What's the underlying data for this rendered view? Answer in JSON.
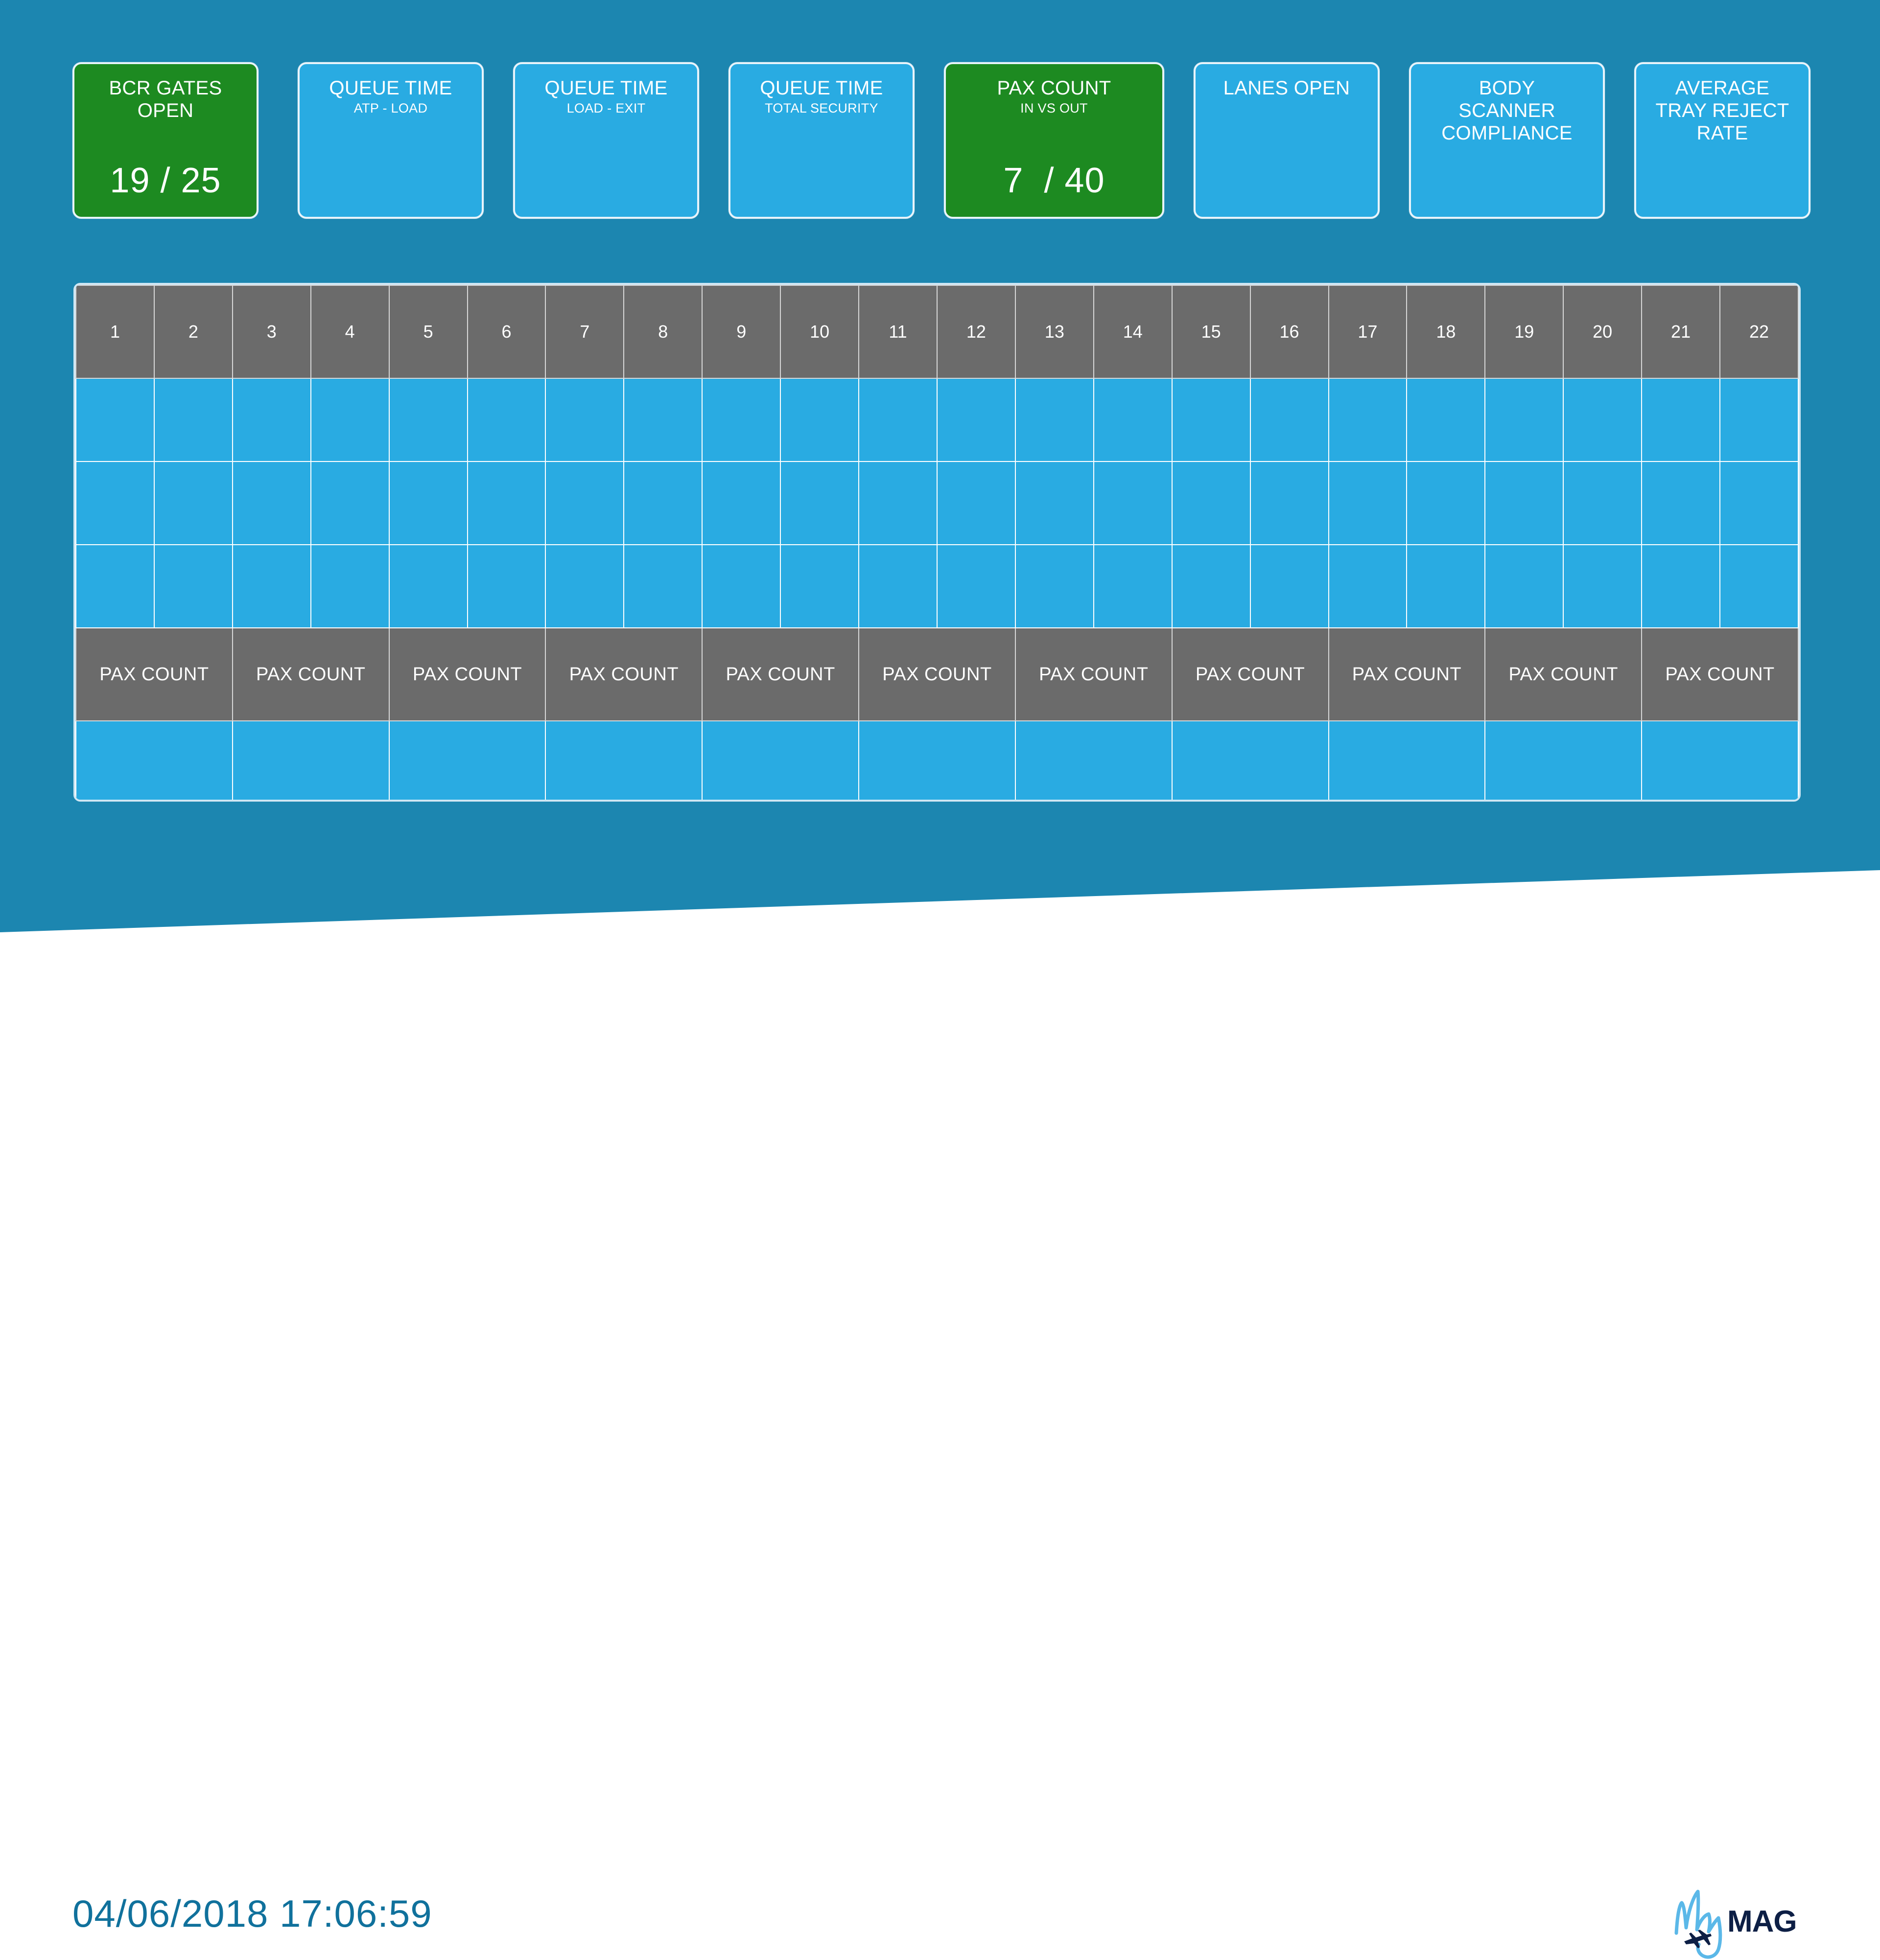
{
  "theme": {
    "background_teal": "#1c86b0",
    "card_blue": "#29abe2",
    "card_green": "#1d8a21",
    "card_border": "#e8f4fb",
    "grid_header_gray": "#6b6b6b",
    "footer_white": "#ffffff",
    "timestamp_color": "#10719c",
    "logo_script_color": "#5bb8e8",
    "logo_text_color": "#0d1f45"
  },
  "kpi_cards": [
    {
      "title": "BCR GATES\nOPEN",
      "subtitle": "",
      "value": "19 / 25",
      "state": "green"
    },
    {
      "title": "QUEUE TIME",
      "subtitle": "ATP - LOAD",
      "value": "",
      "state": "blue"
    },
    {
      "title": "QUEUE TIME",
      "subtitle": "LOAD - EXIT",
      "value": "",
      "state": "blue"
    },
    {
      "title": "QUEUE TIME",
      "subtitle": "TOTAL SECURITY",
      "value": "",
      "state": "blue"
    },
    {
      "title": "PAX COUNT",
      "subtitle": "IN VS OUT",
      "value": "7  / 40",
      "state": "green"
    },
    {
      "title": "LANES OPEN",
      "subtitle": "",
      "value": "",
      "state": "blue"
    },
    {
      "title": "BODY\nSCANNER\nCOMPLIANCE",
      "subtitle": "",
      "value": "",
      "state": "blue"
    },
    {
      "title": "AVERAGE\nTRAY REJECT\nRATE",
      "subtitle": "",
      "value": "",
      "state": "blue"
    }
  ],
  "grid": {
    "column_headers": [
      "1",
      "2",
      "3",
      "4",
      "5",
      "6",
      "7",
      "8",
      "9",
      "10",
      "11",
      "12",
      "13",
      "14",
      "15",
      "16",
      "17",
      "18",
      "19",
      "20",
      "21",
      "22"
    ],
    "blank_row_1": [
      "",
      "",
      "",
      "",
      "",
      "",
      "",
      "",
      "",
      "",
      "",
      "",
      "",
      "",
      "",
      "",
      "",
      "",
      "",
      "",
      "",
      ""
    ],
    "blank_row_2": [
      "",
      "",
      "",
      "",
      "",
      "",
      "",
      "",
      "",
      "",
      "",
      "",
      "",
      "",
      "",
      "",
      "",
      "",
      "",
      "",
      "",
      ""
    ],
    "blank_row_3": [
      "",
      "",
      "",
      "",
      "",
      "",
      "",
      "",
      "",
      "",
      "",
      "",
      "",
      "",
      "",
      "",
      "",
      "",
      "",
      "",
      "",
      ""
    ],
    "pax_count_row": [
      "PAX COUNT",
      "PAX COUNT",
      "PAX COUNT",
      "PAX COUNT",
      "PAX COUNT",
      "PAX COUNT",
      "PAX COUNT",
      "PAX COUNT",
      "PAX COUNT",
      "PAX COUNT",
      "PAX COUNT"
    ],
    "pax_value_row": [
      "",
      "",
      "",
      "",
      "",
      "",
      "",
      "",
      "",
      "",
      ""
    ]
  },
  "footer": {
    "timestamp": "04/06/2018 17:06:59",
    "logo_script": "My",
    "logo_text": "MAG"
  }
}
